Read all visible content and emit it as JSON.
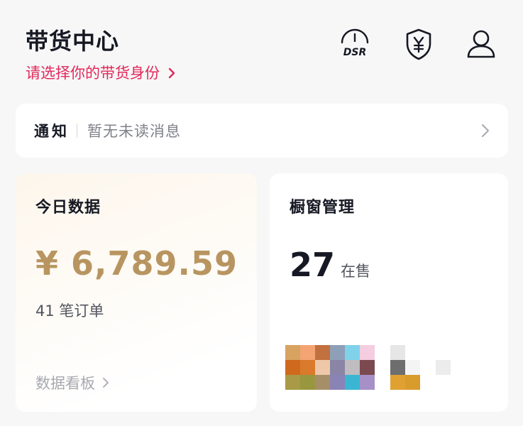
{
  "header": {
    "title": "带货中心",
    "identity_link": "请选择你的带货身份",
    "icons": [
      "dsr-gauge-icon",
      "shield-yen-icon",
      "user-icon"
    ],
    "dsr_label": "DSR",
    "accent_color": "#e2285a"
  },
  "notice": {
    "label": "通知",
    "text": "暂无未读消息"
  },
  "today_data": {
    "title": "今日数据",
    "revenue": "¥ 6,789.59",
    "orders": "41 笔订单",
    "dashboard_link": "数据看板",
    "revenue_color": "#b89560"
  },
  "showcase": {
    "title": "橱窗管理",
    "count": "27",
    "count_unit": "在售",
    "thumbnails": [
      {
        "name": "product-thumbnail-1",
        "colors": [
          "#d8a260",
          "#f4a472",
          "#c2703e",
          "#8ea0b8",
          "#7fd2ea",
          "#f5cde0",
          "#cf6a1c",
          "#d97a2c",
          "#efc8aa",
          "#8a85a6",
          "#c0bcc0",
          "#7a4a50",
          "#a89a46",
          "#98963e",
          "#a68e68",
          "#8a83b6",
          "#3ab6d2",
          "#a790c8"
        ]
      },
      {
        "name": "product-thumbnail-2",
        "colors": [
          "#e6e6e6",
          "#ffffff",
          "#6e6e6e",
          "#f4f4f4",
          "#e0a032",
          "#d89c2c"
        ]
      },
      {
        "name": "product-thumbnail-3",
        "colors": [
          "#ececec"
        ]
      }
    ]
  }
}
